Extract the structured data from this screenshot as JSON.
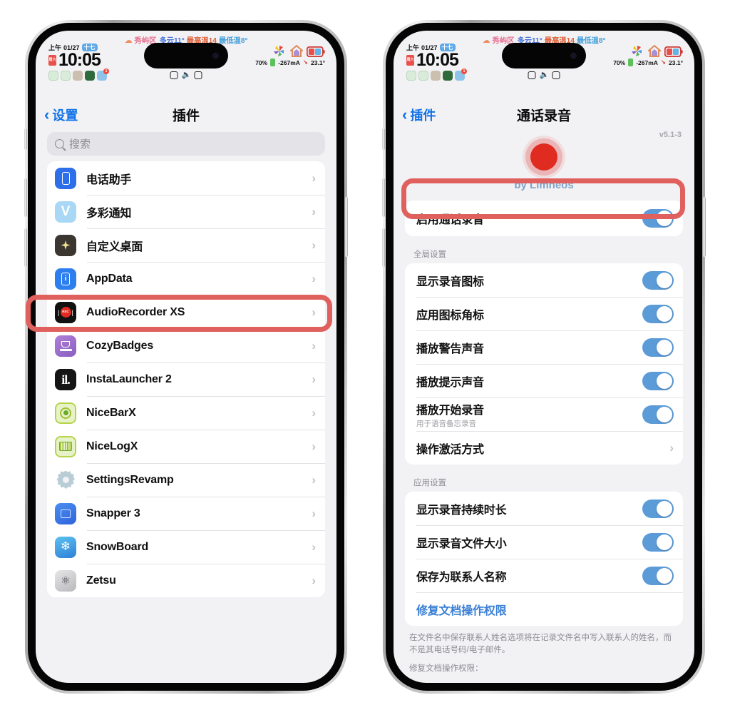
{
  "status_bar": {
    "weather": {
      "cloud_icon": "cloud-icon",
      "location": "秀屿区",
      "condition": "多云11°",
      "high": "最高温14",
      "low": "最低温8°"
    },
    "period": "上午",
    "date": "01/27",
    "lunar": "十七",
    "cal_top": "周六",
    "cal_bottom": "27",
    "time": "10:05",
    "battery_percent": "70%",
    "current": "-267mA",
    "temperature": "23.1°",
    "mini_badge_count": "1"
  },
  "left_phone": {
    "nav": {
      "back_label": "设置",
      "title": "插件"
    },
    "search": {
      "placeholder": "搜索"
    },
    "items": [
      {
        "label": "电话助手",
        "icon": "phone-assistant-icon"
      },
      {
        "label": "多彩通知",
        "icon": "colorful-notify-icon"
      },
      {
        "label": "自定义桌面",
        "icon": "custom-desktop-icon"
      },
      {
        "label": "AppData",
        "icon": "appdata-icon"
      },
      {
        "label": "AudioRecorder XS",
        "icon": "audiorecorder-icon"
      },
      {
        "label": "CozyBadges",
        "icon": "cozybadges-icon"
      },
      {
        "label": "InstaLauncher 2",
        "icon": "instalauncher-icon"
      },
      {
        "label": "NiceBarX",
        "icon": "nicebarx-icon"
      },
      {
        "label": "NiceLogX",
        "icon": "nicelogx-icon"
      },
      {
        "label": "SettingsRevamp",
        "icon": "settingsrevamp-icon"
      },
      {
        "label": "Snapper 3",
        "icon": "snapper-icon"
      },
      {
        "label": "SnowBoard",
        "icon": "snowboard-icon"
      },
      {
        "label": "Zetsu",
        "icon": "zetsu-icon"
      }
    ],
    "highlight_label": "AudioRecorder XS"
  },
  "right_phone": {
    "nav": {
      "back_label": "插件",
      "title": "通话录音"
    },
    "version": "v5.1-3",
    "brand": "by Limneos",
    "master": {
      "label": "启用通话录音",
      "enabled": true
    },
    "sections": [
      {
        "title": "全局设置",
        "rows": [
          {
            "label": "显示录音图标",
            "type": "toggle",
            "enabled": true
          },
          {
            "label": "应用图标角标",
            "type": "toggle",
            "enabled": true
          },
          {
            "label": "播放警告声音",
            "type": "toggle",
            "enabled": true
          },
          {
            "label": "播放提示声音",
            "type": "toggle",
            "enabled": true
          },
          {
            "label": "播放开始录音",
            "sub": "用于语音备忘录音",
            "type": "toggle",
            "enabled": true
          },
          {
            "label": "操作激活方式",
            "type": "disclosure"
          }
        ]
      },
      {
        "title": "应用设置",
        "rows": [
          {
            "label": "显示录音持续时长",
            "type": "toggle",
            "enabled": true
          },
          {
            "label": "显示录音文件大小",
            "type": "toggle",
            "enabled": true
          },
          {
            "label": "保存为联系人名称",
            "type": "toggle",
            "enabled": true
          },
          {
            "label": "修复文档操作权限",
            "type": "link"
          }
        ]
      }
    ],
    "footnote": "在文件名中保存联系人姓名选项将在记录文件名中写入联系人的姓名，而不是其电话号码/电子邮件。",
    "footnote2": "修复文档操作权限："
  },
  "colors": {
    "highlight": "#e0605e",
    "toggle_on": "#5b9bd8",
    "link": "#3a7fd5",
    "nav_tint": "#1273e8",
    "screen_bg": "#f2f2f5"
  }
}
